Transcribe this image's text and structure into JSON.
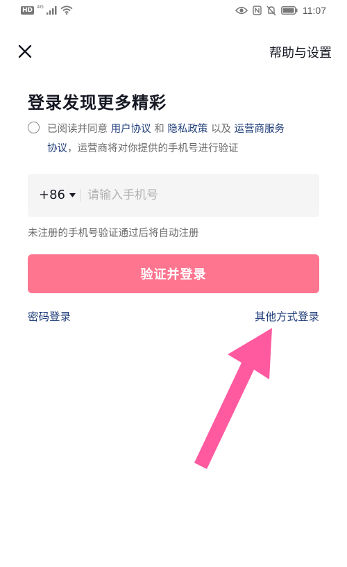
{
  "status_bar": {
    "hd": "HD",
    "network": "4G",
    "time": "11:07"
  },
  "header": {
    "close_icon": "close-icon",
    "help_label": "帮助与设置"
  },
  "title": "登录发现更多精彩",
  "agreement": {
    "prefix": "已阅读并同意",
    "user_agreement": "用户协议",
    "and": "和",
    "privacy_policy": "隐私政策",
    "and2": "以及",
    "carrier_service_1": "运营商服务",
    "carrier_service_2": "协议",
    "suffix": "，运营商将对你提供的手机号进行验证"
  },
  "phone": {
    "country_code": "+86",
    "placeholder": "请输入手机号",
    "value": ""
  },
  "hint": "未注册的手机号验证通过后将自动注册",
  "submit_label": "验证并登录",
  "password_login_label": "密码登录",
  "other_login_label": "其他方式登录",
  "colors": {
    "accent": "#fe7590",
    "link": "#1f3d7a",
    "arrow": "#ff5aa0"
  }
}
